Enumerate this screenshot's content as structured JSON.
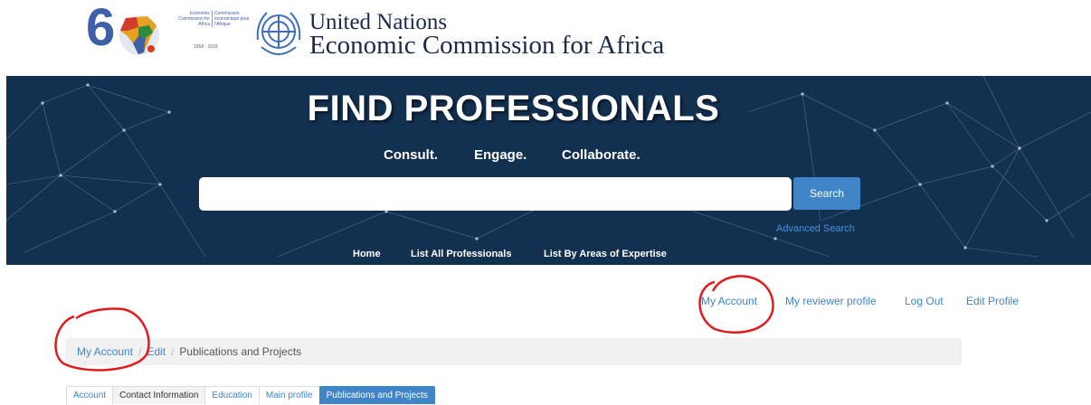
{
  "header": {
    "logo_number": "6",
    "commission_en": [
      "Economic",
      "Commission for",
      "Africa"
    ],
    "commission_fr": [
      "Commission",
      "économique pour",
      "l'Afrique"
    ],
    "years": "1958 · 2018",
    "un_line1": "United Nations",
    "un_line2": "Economic Commission for Africa"
  },
  "hero": {
    "title": "FIND PROFESSIONALS",
    "tagline": [
      "Consult.",
      "Engage.",
      "Collaborate."
    ],
    "search_placeholder": "",
    "search_button": "Search",
    "advanced_search": "Advanced Search",
    "nav": [
      "Home",
      "List All Professionals",
      "List By Areas of Expertise"
    ]
  },
  "account_links": [
    "My Account",
    "My reviewer profile",
    "Log Out",
    "Edit Profile"
  ],
  "breadcrumb": [
    "My Account",
    "Edit",
    "Publications and Projects"
  ],
  "tabs": [
    "Account",
    "Contact Information",
    "Education",
    "Main profile",
    "Publications and Projects"
  ],
  "colors": {
    "hero_bg": "#123050",
    "link": "#3f85c8",
    "annotation": "#e11b1b"
  }
}
